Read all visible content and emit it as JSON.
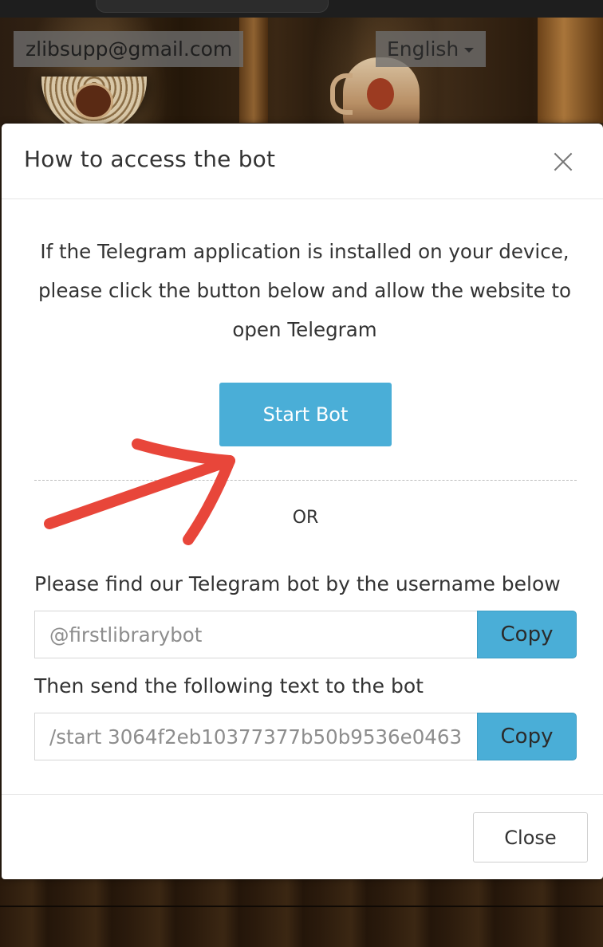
{
  "background": {
    "email": "zlibsupp@gmail.com",
    "language": "English"
  },
  "modal": {
    "title": "How to access the bot",
    "intro": "If the Telegram application is installed on your device, please click the button below and allow the website to open Telegram",
    "start_button": "Start Bot",
    "or_label": "OR",
    "find_label": "Please find our Telegram bot by the username below",
    "username_value": "@firstlibrarybot",
    "copy_label": "Copy",
    "send_label": "Then send the following text to the bot",
    "start_command_value": "/start 3064f2eb10377377b50b9536e0463",
    "close_button": "Close"
  },
  "colors": {
    "accent": "#4aaed7",
    "annotation": "#e8463a"
  },
  "icons": {
    "close": "close-icon",
    "dropdown": "caret-down-icon",
    "annotation": "red-arrow"
  }
}
